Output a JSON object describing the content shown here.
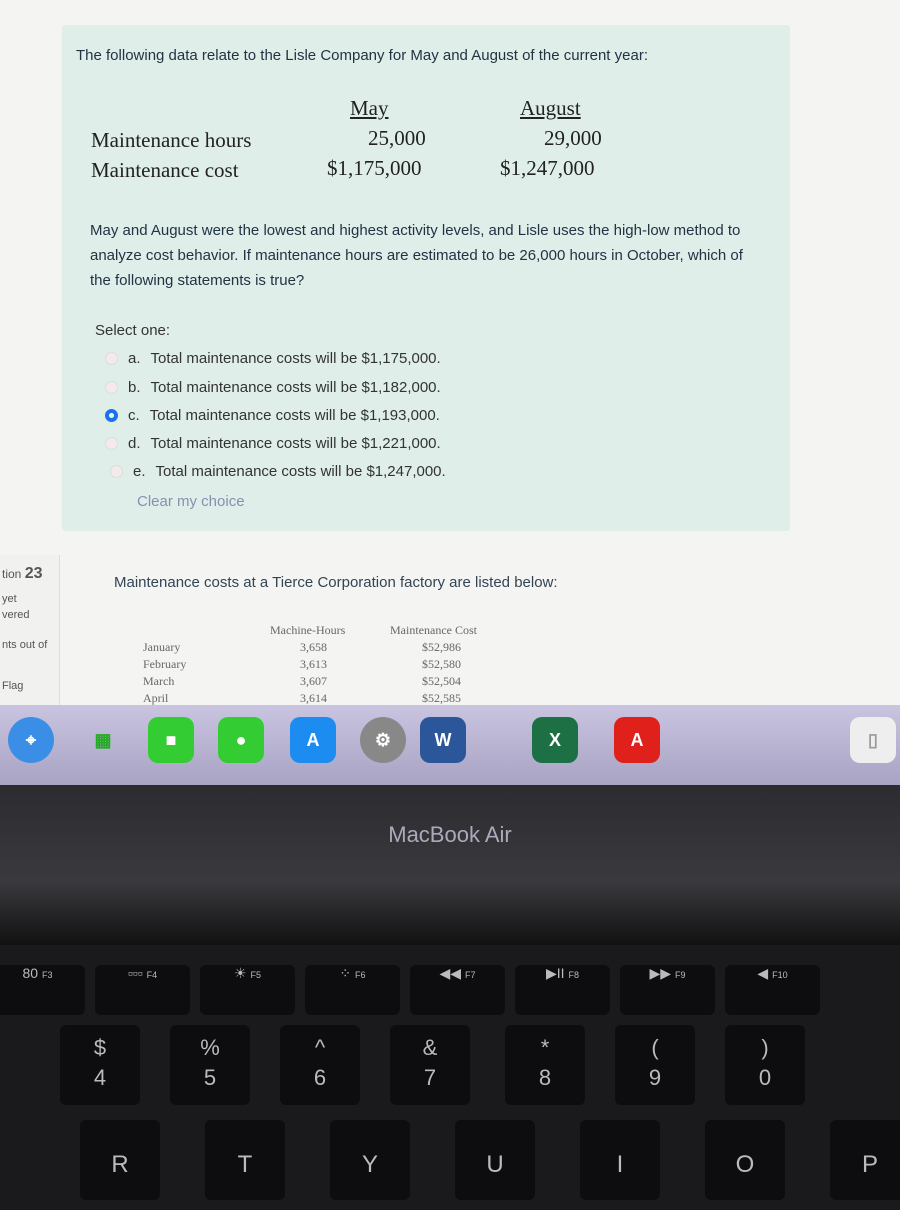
{
  "question_prev": {
    "intro": "The following data relate to the Lisle Company for May and August of the current year:",
    "columns": [
      "May",
      "August"
    ],
    "rows": [
      {
        "label": "Maintenance hours",
        "values": [
          "25,000",
          "29,000"
        ]
      },
      {
        "label": "Maintenance cost",
        "values": [
          "$1,175,000",
          "$1,247,000"
        ]
      }
    ],
    "prompt": "May and August were the lowest and highest activity levels, and Lisle uses the high-low method to analyze cost behavior. If maintenance hours are estimated to be 26,000 hours in October, which of the following statements is true?",
    "select_label": "Select one:",
    "options": [
      {
        "letter": "a.",
        "text": "Total maintenance costs will be $1,175,000.",
        "selected": false
      },
      {
        "letter": "b.",
        "text": "Total maintenance costs will be $1,182,000.",
        "selected": false
      },
      {
        "letter": "c.",
        "text": "Total maintenance costs will be $1,193,000.",
        "selected": true
      },
      {
        "letter": "d.",
        "text": "Total maintenance costs will be $1,221,000.",
        "selected": false
      },
      {
        "letter": "e.",
        "text": "Total maintenance costs will be $1,247,000.",
        "selected": false
      }
    ],
    "clear": "Clear my choice"
  },
  "sidebar": {
    "question": "tion",
    "number": "23",
    "status1": "yet",
    "status2": "vered",
    "points": "nts out of",
    "flag": "Flag"
  },
  "question_next": {
    "intro": "Maintenance costs at a Tierce Corporation factory are listed below:",
    "headers": [
      "Machine-Hours",
      "Maintenance Cost"
    ],
    "rows": [
      {
        "month": "January",
        "hours": "3,658",
        "cost": "$52,986"
      },
      {
        "month": "February",
        "hours": "3,613",
        "cost": "$52,580"
      },
      {
        "month": "March",
        "hours": "3,607",
        "cost": "$52,504"
      },
      {
        "month": "April",
        "hours": "3,614",
        "cost": "$52,585"
      }
    ]
  },
  "dock": {
    "word": "W",
    "excel": "X"
  },
  "laptop": {
    "brand": "MacBook Air"
  },
  "keyboard": {
    "fn": [
      "F3",
      "F4",
      "F5",
      "F6",
      "F7",
      "F8",
      "F9",
      "F10"
    ],
    "fn_icons": [
      "80",
      "▫▫▫",
      "☀",
      "⁘",
      "◀◀",
      "▶II",
      "▶▶",
      "◀"
    ],
    "num": [
      {
        "top": "$",
        "bot": "4"
      },
      {
        "top": "%",
        "bot": "5"
      },
      {
        "top": "^",
        "bot": "6"
      },
      {
        "top": "&",
        "bot": "7"
      },
      {
        "top": "*",
        "bot": "8"
      },
      {
        "top": "(",
        "bot": "9"
      },
      {
        "top": ")",
        "bot": "0"
      }
    ],
    "letters": [
      "R",
      "T",
      "Y",
      "U",
      "I",
      "O",
      "P"
    ]
  },
  "colors": {
    "question_bg": "#dfeee9",
    "radio_selected": "#1a73e8",
    "link": "#8a8fb0"
  }
}
